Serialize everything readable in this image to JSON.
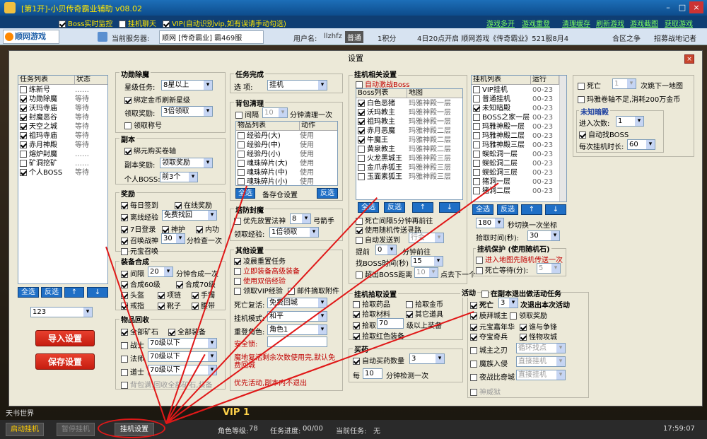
{
  "window": {
    "title": "[第1开]-小贝传奇霸业辅助 v08.02",
    "controls": [
      "–",
      "□",
      "×"
    ]
  },
  "optbar": {
    "boss_monitor": "Boss实时监控",
    "hang_chat": "挂机聊天",
    "vip": "VIP(自动识别vip,如有误请手动勾选)",
    "links": [
      "游戏多开",
      "游戏重登",
      "清理缓存",
      "刷新游戏",
      "游戏截图",
      "获取游戏"
    ]
  },
  "infobar": {
    "logo": "顺网游戏",
    "server_label": "当前服务器:",
    "server_value": "顺网 [传奇霸业] 霸469服",
    "user_label": "用户名:",
    "user_value": "llzhfz",
    "level": "普通",
    "points": "1积分",
    "announce": "4日20点开启  顺网游戏《传奇霸业》521服8月4",
    "right1": "合区之争",
    "right2": "招募战地记者"
  },
  "dialog": {
    "title": "设置",
    "close": "×"
  },
  "tasks": {
    "col1": "任务列表",
    "col2": "状态",
    "items": [
      {
        "name": "练新号",
        "status": "……",
        "checked": false
      },
      {
        "name": "功勋除魔",
        "status": "等待",
        "checked": true
      },
      {
        "name": "沃玛寺庙",
        "status": "等待",
        "checked": true
      },
      {
        "name": "封魔恶谷",
        "status": "等待",
        "checked": true
      },
      {
        "name": "天空之城",
        "status": "等待",
        "checked": true
      },
      {
        "name": "祖玛寺庙",
        "status": "等待",
        "checked": true
      },
      {
        "name": "赤月神殿",
        "status": "等待",
        "checked": true
      },
      {
        "name": "熔炉封魔",
        "status": "……",
        "checked": false
      },
      {
        "name": "矿洞挖矿",
        "status": "……",
        "checked": false
      },
      {
        "name": "个人BOSS",
        "status": "等待",
        "checked": true
      }
    ],
    "btns": [
      "全选",
      "反选",
      "↑",
      "↓"
    ],
    "combo": "123",
    "import": "导入设置",
    "save": "保存设置"
  },
  "merit": {
    "head": "功勋除魔",
    "star_label": "星级任务:",
    "star_value": "8星以上",
    "bind_refresh": "绑定金币刷新星级",
    "reward_label": "领取奖励:",
    "reward_value": "3倍领取",
    "title": "领取称号"
  },
  "dungeon": {
    "head": "副本",
    "bind_buy": "绑元购买卷轴",
    "reward_label": "副本奖励:",
    "reward_value": "领取奖励",
    "boss_label": "个人BOSS:",
    "boss_value": "前3个"
  },
  "rewards": {
    "head": "奖励",
    "daily": "每日签到",
    "online": "在线奖励",
    "offline": "离线经验",
    "offline_value": "免费找回",
    "login7": "7日登录",
    "guard": "神护",
    "inner": "内功",
    "summon": "召唤战神",
    "summon_value": "30",
    "summon_tail": "分检查一次",
    "yuanbao": "元宝召唤"
  },
  "equipfuse": {
    "head": "装备合成",
    "interval": "间隔",
    "interval_value": "20",
    "interval_tail": "分钟合成一次",
    "g60": "合成60级",
    "g70": "合成70级",
    "helmet": "头盔",
    "necklace": "项链",
    "bracelet": "手镯",
    "ring": "戒指",
    "boots": "靴子",
    "belt": "腰带"
  },
  "recycle": {
    "head": "物品回收",
    "ore": "全部矿石",
    "all_equip": "全部装备",
    "warrior": "战士",
    "warrior_v": "70级以下",
    "mage": "法师",
    "mage_v": "70级以下",
    "tao": "道士",
    "tao_v": "70级以下",
    "bagfull": "背包满:回收全部矿石,装备"
  },
  "taskdone": {
    "head": "任务完成",
    "label": "选  项:",
    "value": "挂机"
  },
  "bagclean": {
    "head": "背包清理",
    "interval": "间隔",
    "interval_v": "10",
    "interval_tail": "分钟清理一次",
    "col1": "物品列表",
    "col2": "动作",
    "items": [
      {
        "n": "经验丹(大)",
        "a": "使用"
      },
      {
        "n": "经验丹(中)",
        "a": "使用"
      },
      {
        "n": "经验丹(小)",
        "a": "使用"
      },
      {
        "n": "魂珠碎片(大)",
        "a": "使用"
      },
      {
        "n": "魂珠碎片(中)",
        "a": "使用"
      },
      {
        "n": "魂珠碎片(小)",
        "a": "使用"
      }
    ],
    "btns": [
      "全选",
      "备存仓设置",
      "反选"
    ]
  },
  "tower": {
    "head": "塔防封魔",
    "buy": "优先放置法神",
    "buy_v": "8",
    "buy_tail": "弓箭手",
    "reward_label": "领取经验:",
    "reward_v": "1倍领取"
  },
  "other": {
    "head": "其他设置",
    "rebirth": "凌晨重置任务",
    "revive": "立即装备高级装备",
    "double": "使用双倍经验",
    "vipexp": "领取VIP经验",
    "mail": "邮件摘取附件",
    "death_label": "死亡复活:",
    "death_v": "免费回城",
    "mode_label": "挂机模式:",
    "mode_v": "和平",
    "role_label": "重登角色:",
    "role_v": "角色1",
    "lock_label": "安全锁:",
    "lock_v": ""
  },
  "hang": {
    "head": "挂机相关设置",
    "autoboss": "自动激战Boss",
    "col1": "Boss列表",
    "col2": "地图",
    "items": [
      {
        "n": "白色恶猪",
        "m": "玛雅神殿一层",
        "c": true
      },
      {
        "n": "沃玛教主",
        "m": "玛雅神殿一层",
        "c": true
      },
      {
        "n": "祖玛教主",
        "m": "玛雅神殿一层",
        "c": true
      },
      {
        "n": "赤月恶魔",
        "m": "玛雅神殿二层",
        "c": true
      },
      {
        "n": "牛魔王",
        "m": "玛雅神殿二层",
        "c": true
      },
      {
        "n": "黄泉教主",
        "m": "玛雅神殿二层",
        "c": false
      },
      {
        "n": "火龙黑城王",
        "m": "玛雅神殿三层",
        "c": false
      },
      {
        "n": "金爪赤狐王",
        "m": "玛雅神殿三层",
        "c": false
      },
      {
        "n": "玉面素狐王",
        "m": "玛雅神殿三层",
        "c": false
      }
    ],
    "btns": [
      "全选",
      "反选",
      "↑",
      "↓"
    ],
    "death5": "死亡间隔5分钟再前往",
    "usetp": "使用随机传送寻路",
    "autosend": "自动发送到",
    "autosend_v": "行会",
    "ahead_label": "提前",
    "ahead_v": "0",
    "ahead_tail": "分钟前往",
    "bosstime_label": "找BOSS时间(秒)",
    "bosstime_v": "15",
    "exceed": "超出BOSS距离",
    "exceed_v": "10",
    "exceed_tail": "点去下一个"
  },
  "maps": {
    "col1": "挂机列表",
    "col2": "运行",
    "items": [
      {
        "n": "VIP挂机",
        "r": "00-23",
        "c": false
      },
      {
        "n": "普通挂机",
        "r": "00-23",
        "c": false
      },
      {
        "n": "未知暗殿",
        "r": "00-23",
        "c": true
      },
      {
        "n": "BOSS之家一层",
        "r": "00-23",
        "c": false
      },
      {
        "n": "玛雅神殿一层",
        "r": "00-23",
        "c": false
      },
      {
        "n": "玛雅神殿二层",
        "r": "00-23",
        "c": false
      },
      {
        "n": "玛雅神殿三层",
        "r": "00-23",
        "c": false
      },
      {
        "n": "蜈蚣洞一层",
        "r": "00-23",
        "c": false
      },
      {
        "n": "蜈蚣洞二层",
        "r": "00-23",
        "c": false
      },
      {
        "n": "蜈蚣洞三层",
        "r": "00-23",
        "c": false
      },
      {
        "n": "猪洞一层",
        "r": "00-23",
        "c": false
      },
      {
        "n": "猪洞二层",
        "r": "00-23",
        "c": false
      }
    ],
    "btns": [
      "全选",
      "反选",
      "↑",
      "↓"
    ],
    "sec_v": "180",
    "sec_tail": "秒切换一次坐标",
    "pick_label": "拾取时间(秒):",
    "pick_v": "30",
    "protect_head": "挂机保护 (使用随机石)",
    "protect1": "进入地图先随机传送一次",
    "protect2": "死亡等待(分):",
    "protect2_v": "5"
  },
  "farright": {
    "death": "死亡",
    "death_v": "1",
    "death_tail": "次跳下一地图",
    "scroll": "玛雅卷轴不足,消耗200万金币",
    "unknown_head": "未知暗殿",
    "enter_label": "进入次数:",
    "enter_v": "1",
    "autoboss": "自动找BOSS",
    "time_label": "每次挂机时长:",
    "time_v": "60"
  },
  "pickup": {
    "head": "挂机拾取设置",
    "drug": "拾取药品",
    "gold": "拾取金币",
    "material": "拾取材料",
    "other": "其它道具",
    "pick": "拾取",
    "pick_v": "70",
    "pick_tail": "级以上装备",
    "red": "拾取红色装备"
  },
  "buydrug": {
    "head": "买药",
    "auto": "自动买药数量",
    "auto_v": "3",
    "every": "每",
    "every_v": "10",
    "every_tail": "分钟检测一次"
  },
  "activity": {
    "head": "活动",
    "exitdungeon": "在副本退出做活动任务",
    "death": "死亡",
    "death_v": "3",
    "death_tail": "次退出本次活动",
    "guild": "膜拜城主",
    "guild_reward": "领取奖励",
    "yuanbao": "元宝嘉年华",
    "pk": "谁与争锋",
    "treasure": "夺宝奇兵",
    "monster": "怪物攻城",
    "king": "城主之刃",
    "king_v": "循环找点",
    "demon": "魔族入侵",
    "demon_v": "直接挂机",
    "night": "夜战比奇城",
    "night_v": "直接挂机",
    "prison": "神威狱"
  },
  "notes": {
    "note1": "魔地复活剩余次数使用完,默认免费回城",
    "note2": "优先活动,副本内不退出"
  },
  "bottom": {
    "start": "启动挂机",
    "pause": "暂停挂机",
    "settings": "挂机设置",
    "level_label": "角色等级:",
    "level_v": "78",
    "progress_label": "任务进度:",
    "progress_v": "00/00",
    "activity_label": "当前任务:",
    "activity_v": "无",
    "time": "17:59:07",
    "vip": "VIP 1",
    "area": "天书世界"
  }
}
